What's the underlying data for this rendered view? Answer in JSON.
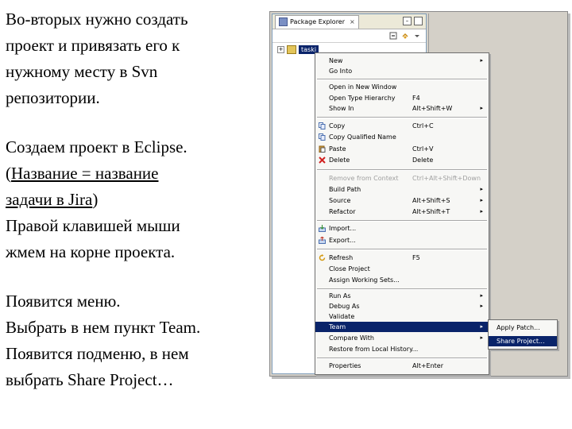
{
  "instructions": {
    "line1": "Во-вторых нужно создать",
    "line2": "проект и привязать его к",
    "line3": "нужному месту в Svn",
    "line4": "репозитории.",
    "line5": "Создаем проект в Eclipse.",
    "line6_prefix": "(",
    "line6_link": "Название = название ",
    "line7_link": "задачи в Jira",
    "line7_suffix": ")",
    "line8": "Правой клавишей мыши",
    "line9": "жмем на корне проекта.",
    "line10": "Появится меню.",
    "line11": "Выбрать в нем пункт Team.",
    "line12": "Появится подменю, в нем",
    "line13": "выбрать Share Project…"
  },
  "package_explorer": {
    "tab_title": "Package Explorer",
    "close_glyph": "×",
    "tree_item": "taski",
    "expander": "+"
  },
  "context_menu": {
    "items": [
      {
        "label": "New",
        "shortcut": "",
        "submenu": true
      },
      {
        "label": "Go Into",
        "shortcut": "",
        "submenu": false
      },
      {
        "label": "Open in New Window",
        "shortcut": "",
        "submenu": false
      },
      {
        "label": "Open Type Hierarchy",
        "shortcut": "F4",
        "submenu": false
      },
      {
        "label": "Show In",
        "shortcut": "Alt+Shift+W",
        "submenu": true
      },
      {
        "label": "Copy",
        "shortcut": "Ctrl+C",
        "submenu": false
      },
      {
        "label": "Copy Qualified Name",
        "shortcut": "",
        "submenu": false
      },
      {
        "label": "Paste",
        "shortcut": "Ctrl+V",
        "submenu": false
      },
      {
        "label": "Delete",
        "shortcut": "Delete",
        "submenu": false
      },
      {
        "label": "Remove from Context",
        "shortcut": "Ctrl+Alt+Shift+Down",
        "submenu": false
      },
      {
        "label": "Build Path",
        "shortcut": "",
        "submenu": true
      },
      {
        "label": "Source",
        "shortcut": "Alt+Shift+S",
        "submenu": true
      },
      {
        "label": "Refactor",
        "shortcut": "Alt+Shift+T",
        "submenu": true
      },
      {
        "label": "Import...",
        "shortcut": "",
        "submenu": false
      },
      {
        "label": "Export...",
        "shortcut": "",
        "submenu": false
      },
      {
        "label": "Refresh",
        "shortcut": "F5",
        "submenu": false
      },
      {
        "label": "Close Project",
        "shortcut": "",
        "submenu": false
      },
      {
        "label": "Assign Working Sets...",
        "shortcut": "",
        "submenu": false
      },
      {
        "label": "Run As",
        "shortcut": "",
        "submenu": true
      },
      {
        "label": "Debug As",
        "shortcut": "",
        "submenu": true
      },
      {
        "label": "Validate",
        "shortcut": "",
        "submenu": false
      },
      {
        "label": "Team",
        "shortcut": "",
        "submenu": true
      },
      {
        "label": "Compare With",
        "shortcut": "",
        "submenu": true
      },
      {
        "label": "Restore from Local History...",
        "shortcut": "",
        "submenu": false
      },
      {
        "label": "Properties",
        "shortcut": "Alt+Enter",
        "submenu": false
      }
    ],
    "arrow": "▸"
  },
  "team_submenu": {
    "items": [
      "Apply Patch...",
      "Share Project..."
    ]
  },
  "colors": {
    "selection": "#0a246a",
    "menu_bg": "#f7f7f5",
    "window_bg": "#d4d0c8"
  }
}
